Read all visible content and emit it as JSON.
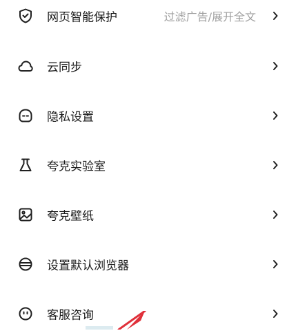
{
  "settings": {
    "items": [
      {
        "label": "网页智能保护",
        "value": "过滤广告/展开全文",
        "icon": "shield-check-icon"
      },
      {
        "label": "云同步",
        "icon": "cloud-icon"
      },
      {
        "label": "隐私设置",
        "icon": "mask-icon"
      },
      {
        "label": "夸克实验室",
        "icon": "flask-icon"
      },
      {
        "label": "夸克壁纸",
        "icon": "image-icon"
      },
      {
        "label": "设置默认浏览器",
        "icon": "browser-globe-icon"
      },
      {
        "label": "客服咨询",
        "icon": "smile-face-icon"
      }
    ]
  },
  "colors": {
    "label": "#1a1a1a",
    "value": "#a0a0a0",
    "icon": "#1f1f1f",
    "chevron": "#1f1f1f",
    "annotation_arrow": "#e0303a"
  }
}
